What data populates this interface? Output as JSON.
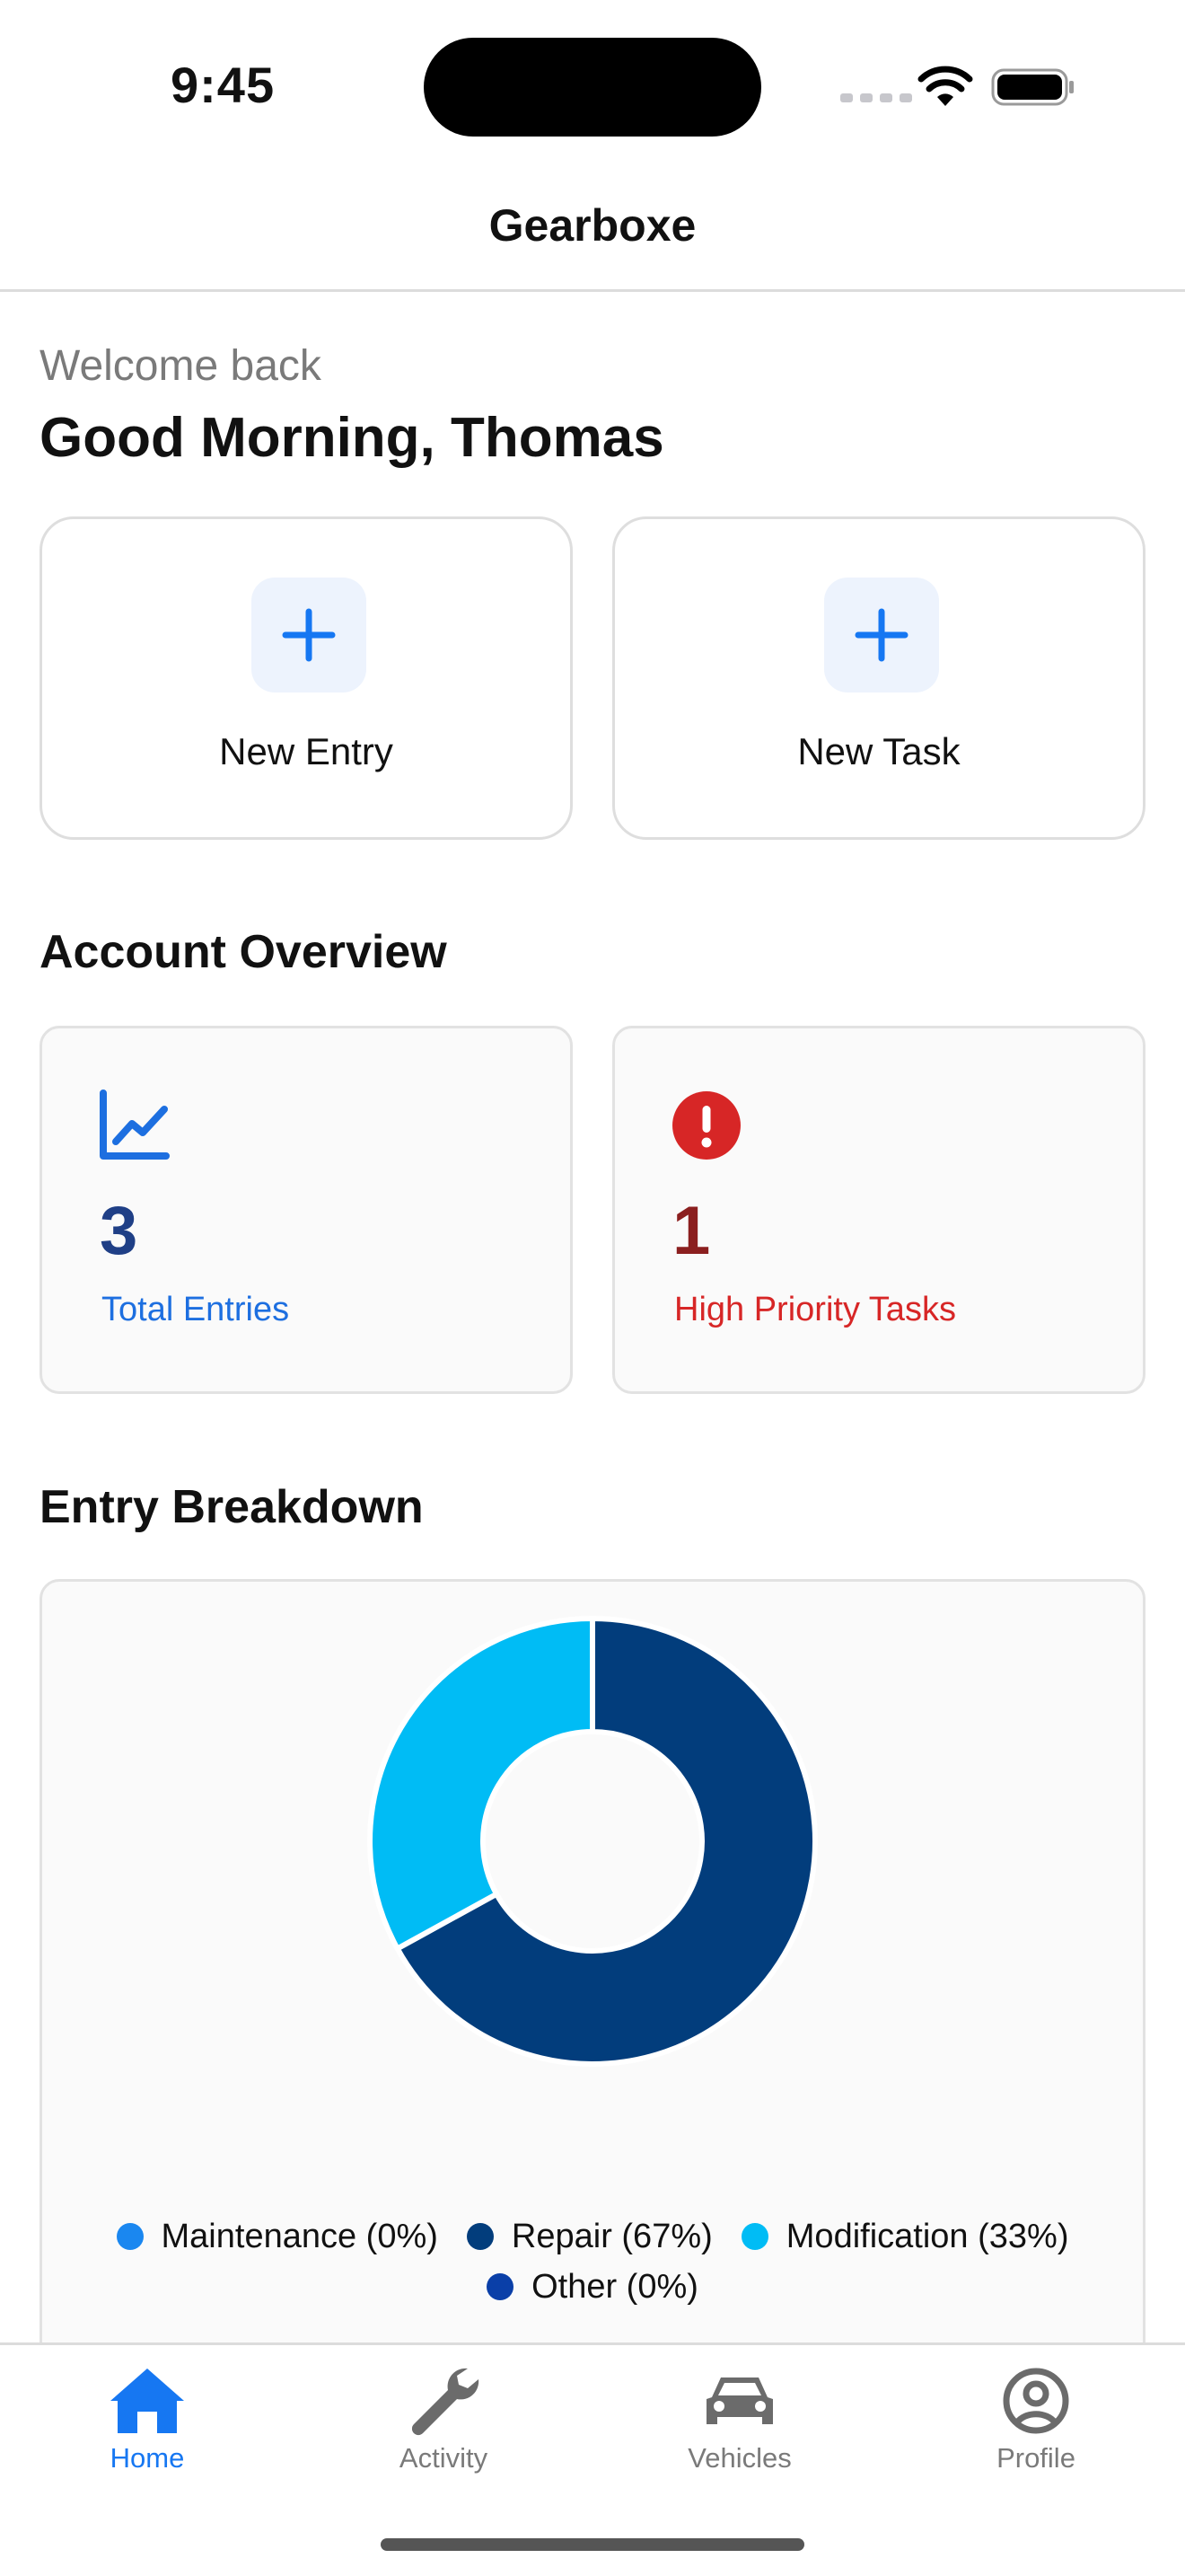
{
  "status_bar": {
    "time": "9:45"
  },
  "header": {
    "title": "Gearboxe"
  },
  "greeting": {
    "welcome": "Welcome back",
    "headline": "Good Morning, Thomas"
  },
  "actions": [
    {
      "label": "New Entry",
      "icon": "plus-icon"
    },
    {
      "label": "New Task",
      "icon": "plus-icon"
    }
  ],
  "overview": {
    "title": "Account Overview",
    "cards": [
      {
        "value": "3",
        "label": "Total Entries",
        "icon": "chart-line-icon",
        "value_color": "#1f3f86",
        "label_color": "#1d6fe0"
      },
      {
        "value": "1",
        "label": "High Priority Tasks",
        "icon": "alert-circle-icon",
        "value_color": "#8b1f1f",
        "label_color": "#d72626"
      }
    ]
  },
  "breakdown": {
    "title": "Entry Breakdown"
  },
  "chart_data": {
    "type": "pie",
    "categories": [
      "Maintenance",
      "Repair",
      "Modification",
      "Other"
    ],
    "values": [
      0,
      67,
      33,
      0
    ],
    "colors": [
      "#1a87f0",
      "#023d7c",
      "#00bcf5",
      "#0a3fa8"
    ],
    "legend": [
      "Maintenance (0%)",
      "Repair (67%)",
      "Modification (33%)",
      "Other (0%)"
    ],
    "legend_position": "bottom"
  },
  "tab_bar": {
    "items": [
      {
        "label": "Home",
        "icon": "home-icon",
        "active": true
      },
      {
        "label": "Activity",
        "icon": "wrench-icon",
        "active": false
      },
      {
        "label": "Vehicles",
        "icon": "car-icon",
        "active": false
      },
      {
        "label": "Profile",
        "icon": "profile-icon",
        "active": false
      }
    ]
  },
  "colors": {
    "accent": "#1677f2",
    "inactive": "#7a7a7a"
  }
}
